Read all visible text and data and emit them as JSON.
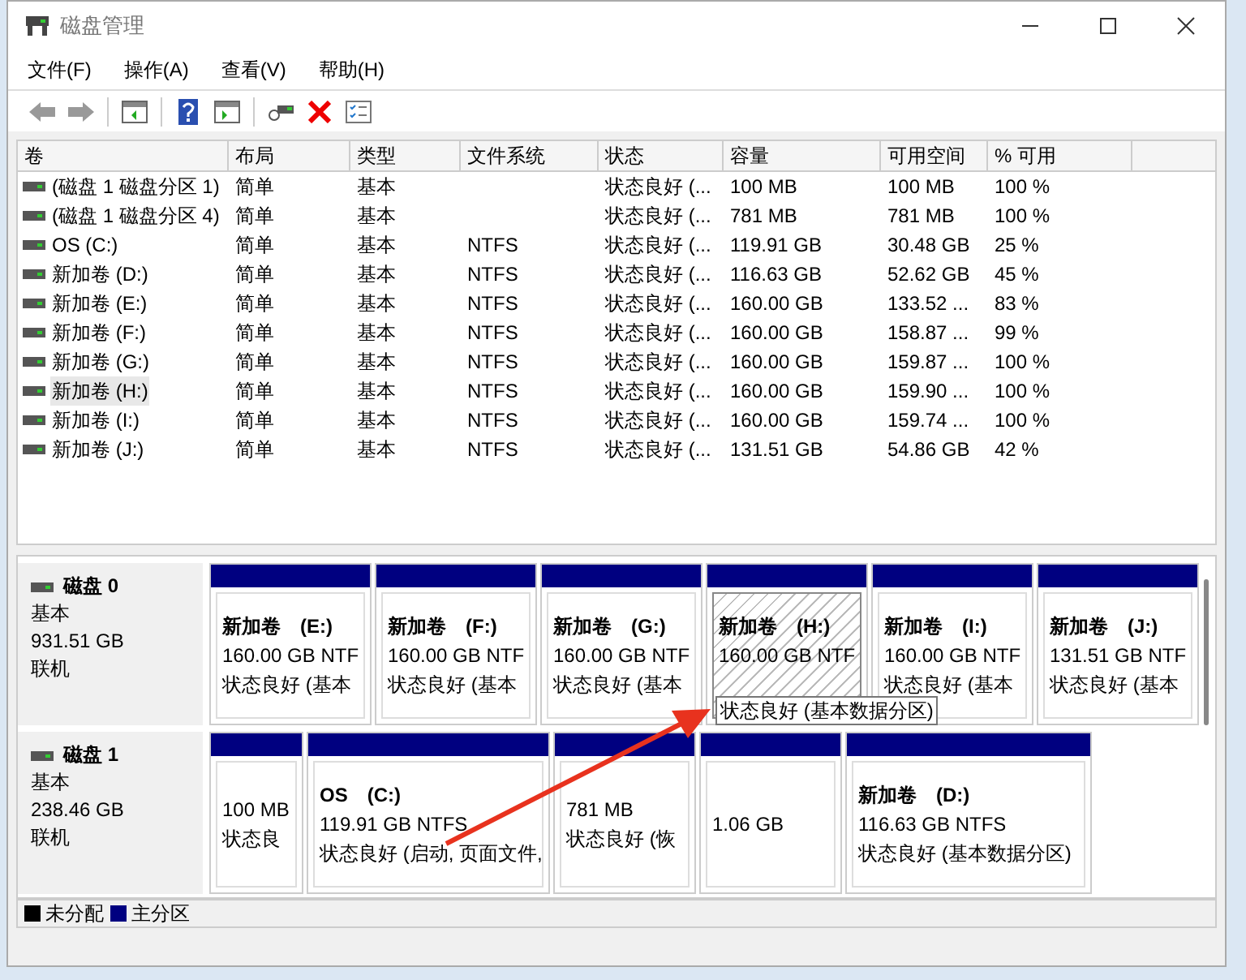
{
  "window": {
    "title": "磁盘管理"
  },
  "menu": [
    "文件(F)",
    "操作(A)",
    "查看(V)",
    "帮助(H)"
  ],
  "table": {
    "columns": [
      "卷",
      "布局",
      "类型",
      "文件系统",
      "状态",
      "容量",
      "可用空间",
      "% 可用"
    ],
    "rows": [
      {
        "cells": [
          "(磁盘 1 磁盘分区 1)",
          "简单",
          "基本",
          "",
          "状态良好 (...",
          "100 MB",
          "100 MB",
          "100 %"
        ],
        "selected": false
      },
      {
        "cells": [
          "(磁盘 1 磁盘分区 4)",
          "简单",
          "基本",
          "",
          "状态良好 (...",
          "781 MB",
          "781 MB",
          "100 %"
        ],
        "selected": false
      },
      {
        "cells": [
          "OS (C:)",
          "简单",
          "基本",
          "NTFS",
          "状态良好 (...",
          "119.91 GB",
          "30.48 GB",
          "25 %"
        ],
        "selected": false
      },
      {
        "cells": [
          "新加卷 (D:)",
          "简单",
          "基本",
          "NTFS",
          "状态良好 (...",
          "116.63 GB",
          "52.62 GB",
          "45 %"
        ],
        "selected": false
      },
      {
        "cells": [
          "新加卷 (E:)",
          "简单",
          "基本",
          "NTFS",
          "状态良好 (...",
          "160.00 GB",
          "133.52 ...",
          "83 %"
        ],
        "selected": false
      },
      {
        "cells": [
          "新加卷 (F:)",
          "简单",
          "基本",
          "NTFS",
          "状态良好 (...",
          "160.00 GB",
          "158.87 ...",
          "99 %"
        ],
        "selected": false
      },
      {
        "cells": [
          "新加卷 (G:)",
          "简单",
          "基本",
          "NTFS",
          "状态良好 (...",
          "160.00 GB",
          "159.87 ...",
          "100 %"
        ],
        "selected": false
      },
      {
        "cells": [
          "新加卷 (H:)",
          "简单",
          "基本",
          "NTFS",
          "状态良好 (...",
          "160.00 GB",
          "159.90 ...",
          "100 %"
        ],
        "selected": true
      },
      {
        "cells": [
          "新加卷 (I:)",
          "简单",
          "基本",
          "NTFS",
          "状态良好 (...",
          "160.00 GB",
          "159.74 ...",
          "100 %"
        ],
        "selected": false
      },
      {
        "cells": [
          "新加卷 (J:)",
          "简单",
          "基本",
          "NTFS",
          "状态良好 (...",
          "131.51 GB",
          "54.86 GB",
          "42 %"
        ],
        "selected": false
      }
    ]
  },
  "disks": [
    {
      "name": "磁盘 0",
      "type": "基本",
      "size": "931.51 GB",
      "status": "联机",
      "partitions": [
        {
          "kind": "primary",
          "name": "新加卷　(E:)",
          "size": "160.00 GB NTF",
          "status": "状态良好 (基本",
          "selected": false
        },
        {
          "kind": "primary",
          "name": "新加卷　(F:)",
          "size": "160.00 GB NTF",
          "status": "状态良好 (基本",
          "selected": false
        },
        {
          "kind": "primary",
          "name": "新加卷　(G:)",
          "size": "160.00 GB NTF",
          "status": "状态良好 (基本",
          "selected": false
        },
        {
          "kind": "primary",
          "name": "新加卷　(H:)",
          "size": "160.00 GB NTF",
          "selected": true,
          "tooltip": "状态良好 (基本数据分区)"
        },
        {
          "kind": "primary",
          "name": "新加卷　(I:)",
          "size": "160.00 GB NTF",
          "status": "状态良好 (基本",
          "selected": false
        },
        {
          "kind": "primary",
          "name": "新加卷　(J:)",
          "size": "131.51 GB NTF",
          "status": "状态良好 (基本",
          "selected": false
        }
      ]
    },
    {
      "name": "磁盘 1",
      "type": "基本",
      "size": "238.46 GB",
      "status": "联机",
      "partitions": [
        {
          "kind": "primary",
          "size": "100 MB",
          "status": "状态良",
          "selected": false
        },
        {
          "kind": "primary",
          "name": "OS　(C:)",
          "size": "119.91 GB NTFS",
          "status": "状态良好 (启动, 页面文件,",
          "selected": false
        },
        {
          "kind": "primary",
          "size": "781 MB",
          "status": "状态良好 (恢",
          "selected": false
        },
        {
          "kind": "primary",
          "size": "1.06 GB",
          "selected": false
        },
        {
          "kind": "primary",
          "name": "新加卷　(D:)",
          "size": "116.63 GB NTFS",
          "status": "状态良好 (基本数据分区)",
          "selected": false
        }
      ]
    }
  ],
  "legend": [
    {
      "label": "未分配",
      "color": "#000000"
    },
    {
      "label": "主分区",
      "color": "#000080"
    }
  ]
}
